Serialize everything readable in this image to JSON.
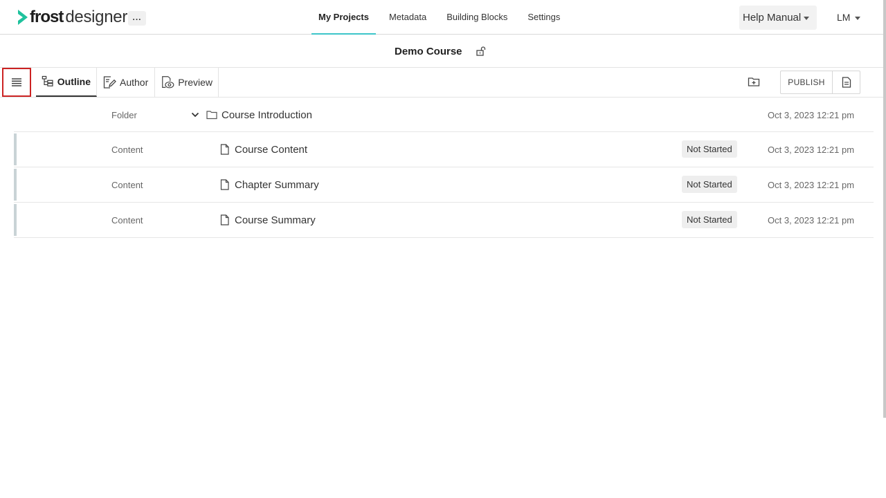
{
  "app": {
    "logo_main": "frost",
    "logo_sub": "designer",
    "more_label": "...",
    "brand_color": "#1fc29d",
    "accent_color": "#3cc5c9"
  },
  "nav": {
    "items": [
      {
        "label": "My Projects",
        "active": true
      },
      {
        "label": "Metadata",
        "active": false
      },
      {
        "label": "Building Blocks",
        "active": false
      },
      {
        "label": "Settings",
        "active": false
      }
    ],
    "help_label": "Help Manual",
    "user_initials": "LM"
  },
  "project": {
    "title": "Demo Course",
    "lock_icon": "unlock-icon"
  },
  "toolbar": {
    "menu_icon": "hamburger-icon",
    "tabs": [
      {
        "label": "Outline",
        "icon": "outline-tree-icon",
        "active": true
      },
      {
        "label": "Author",
        "icon": "edit-document-icon",
        "active": false
      },
      {
        "label": "Preview",
        "icon": "preview-eye-icon",
        "active": false
      }
    ],
    "add_folder_icon": "folder-plus-icon",
    "publish_label": "PUBLISH",
    "doc_icon": "document-icon"
  },
  "outline": {
    "rows": [
      {
        "type": "Folder",
        "name": "Course Introduction",
        "icon": "folder-icon",
        "status": "",
        "date": "Oct 3, 2023 12:21 pm"
      },
      {
        "type": "Content",
        "name": "Course Content",
        "icon": "file-icon",
        "status": "Not Started",
        "date": "Oct 3, 2023 12:21 pm"
      },
      {
        "type": "Content",
        "name": "Chapter Summary",
        "icon": "file-icon",
        "status": "Not Started",
        "date": "Oct 3, 2023 12:21 pm"
      },
      {
        "type": "Content",
        "name": "Course Summary",
        "icon": "file-icon",
        "status": "Not Started",
        "date": "Oct 3, 2023 12:21 pm"
      }
    ]
  }
}
